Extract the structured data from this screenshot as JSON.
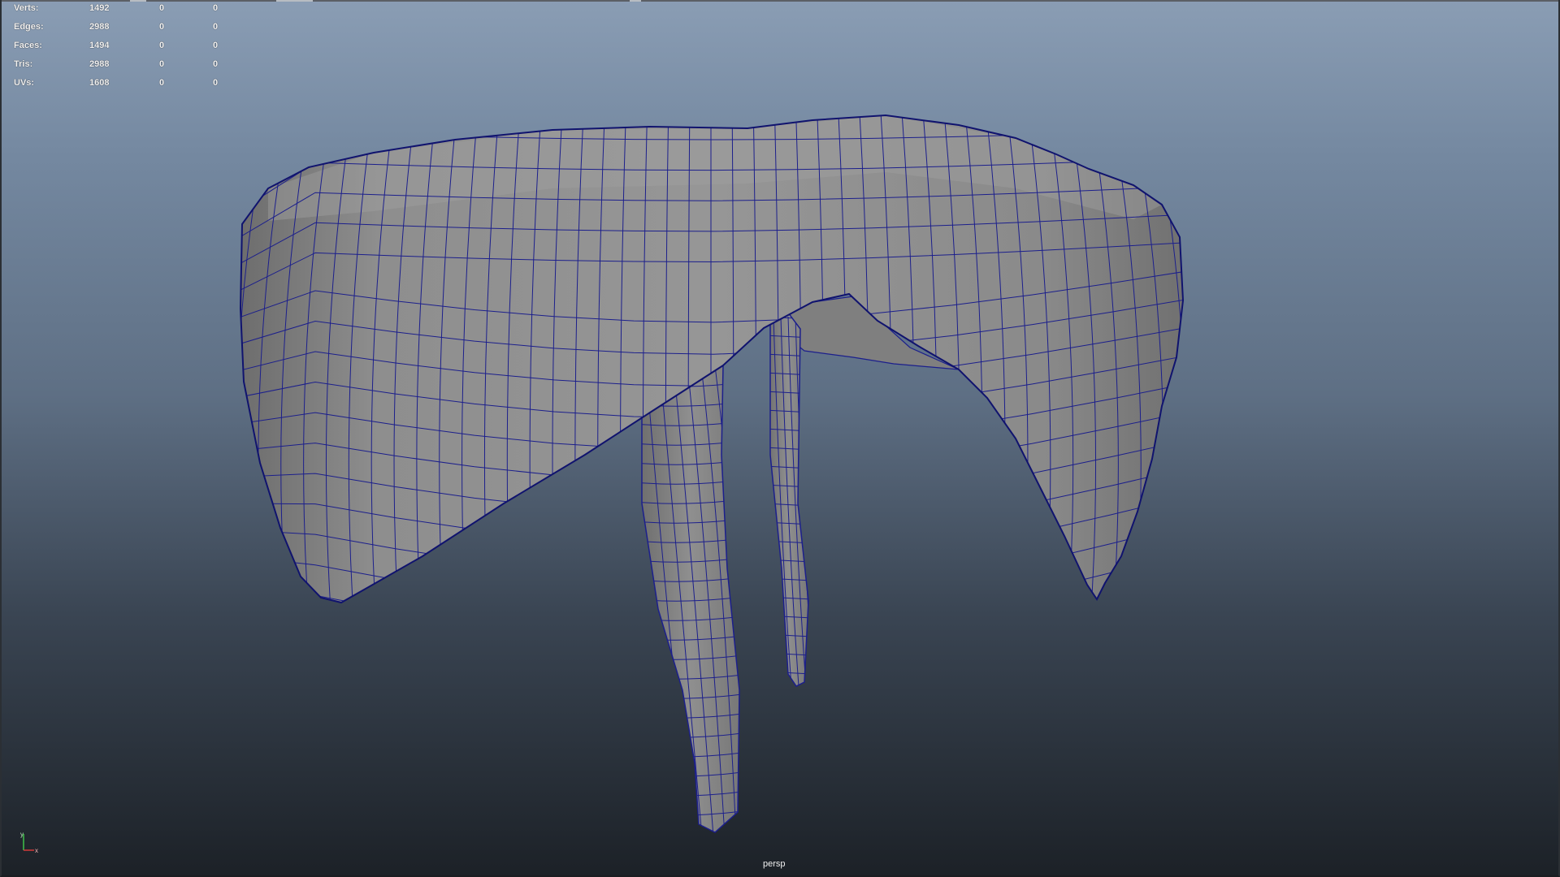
{
  "viewport": {
    "camera_label": "persp",
    "background_colors": [
      "#8a9db4",
      "#1c2127"
    ],
    "mesh_color": "#8c8c8c",
    "wire_color": "#1c1f8c"
  },
  "heads_up_display": {
    "rows": [
      {
        "label": "Verts:",
        "values": [
          "1492",
          "0",
          "0"
        ]
      },
      {
        "label": "Edges:",
        "values": [
          "2988",
          "0",
          "0"
        ]
      },
      {
        "label": "Faces:",
        "values": [
          "1494",
          "0",
          "0"
        ]
      },
      {
        "label": "Tris:",
        "values": [
          "2988",
          "0",
          "0"
        ]
      },
      {
        "label": "UVs:",
        "values": [
          "1608",
          "0",
          "0"
        ]
      }
    ]
  },
  "axis_gizmo": {
    "y_label": "y",
    "x_label": "x",
    "icon": "view-axis-icon"
  }
}
